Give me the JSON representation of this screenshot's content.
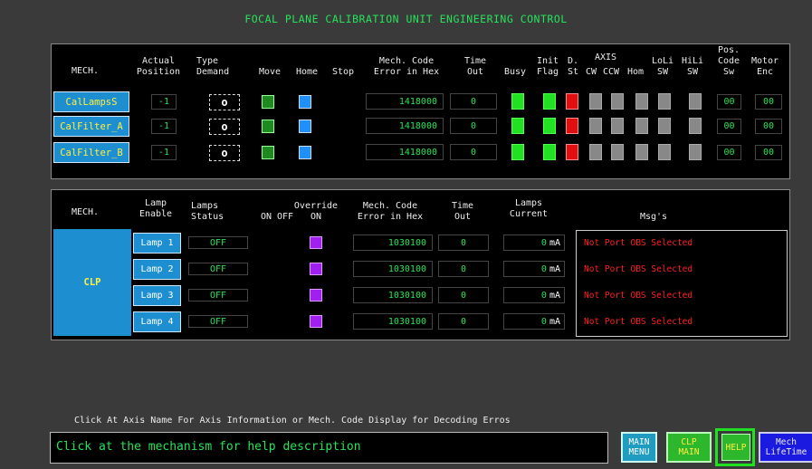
{
  "title": "FOCAL PLANE CALIBRATION UNIT ENGINEERING CONTROL",
  "mech_table": {
    "headers": {
      "mech": "MECH.",
      "actual": "Actual\nPosition",
      "type_demand": "Type\nDemand",
      "move": "Move",
      "home": "Home",
      "stop": "Stop",
      "mech_code": "Mech. Code\nError in Hex",
      "time_out": "Time\nOut",
      "busy": "Busy",
      "init_flag": "Init\nFlag",
      "d_st": "D.\nSt",
      "axis": "AXIS",
      "cw": "CW",
      "ccw": "CCW",
      "hom": "Hom",
      "loli": "LoLi\nSW",
      "hili": "HiLi\nSW",
      "pos_code": "Pos.\nCode\nSw",
      "motor_enc": "Motor\nEnc"
    },
    "rows": [
      {
        "name": "CalLampsS",
        "position": "-1",
        "demand": "o",
        "code": "1418000",
        "timeout": "0",
        "pos_code": "00",
        "motor_enc": "00"
      },
      {
        "name": "CalFilter_A",
        "position": "-1",
        "demand": "o",
        "code": "1418000",
        "timeout": "0",
        "pos_code": "00",
        "motor_enc": "00"
      },
      {
        "name": "CalFilter_B",
        "position": "-1",
        "demand": "o",
        "code": "1418000",
        "timeout": "0",
        "pos_code": "00",
        "motor_enc": "00"
      }
    ]
  },
  "lamp_table": {
    "headers": {
      "mech": "MECH.",
      "lamp_enable": "Lamp\nEnable",
      "lamps_status": "Lamps\nStatus",
      "on_off": "ON OFF",
      "override": "Override\nON",
      "mech_code": "Mech. Code\nError in Hex",
      "time_out": "Time\nOut",
      "lamps_current": "Lamps\nCurrent",
      "msgs": "Msg's"
    },
    "clp_label": "CLP",
    "rows": [
      {
        "lamp": "Lamp 1",
        "status": "OFF",
        "code": "1030100",
        "timeout": "0",
        "current": "0",
        "unit": "mA",
        "msg": "Not Port OBS Selected"
      },
      {
        "lamp": "Lamp 2",
        "status": "OFF",
        "code": "1030100",
        "timeout": "0",
        "current": "0",
        "unit": "mA",
        "msg": "Not Port OBS Selected"
      },
      {
        "lamp": "Lamp 3",
        "status": "OFF",
        "code": "1030100",
        "timeout": "0",
        "current": "0",
        "unit": "mA",
        "msg": "Not Port OBS Selected"
      },
      {
        "lamp": "Lamp 4",
        "status": "OFF",
        "code": "1030100",
        "timeout": "0",
        "current": "0",
        "unit": "mA",
        "msg": "Not Port OBS Selected"
      }
    ]
  },
  "hint": "Click At Axis Name For Axis Information or Mech. Code Display for Decoding Erros",
  "help_text": "Click at the mechanism for help description",
  "nav": {
    "main_menu": "MAIN\nMENU",
    "clp_main": "CLP\nMAIN",
    "help": "HELP",
    "mech_lifetime": "Mech\nLifeTime"
  },
  "colors": {
    "accent_green": "#27e35a",
    "mech_button": "#1d8fd1",
    "error_red": "#ff2020"
  }
}
